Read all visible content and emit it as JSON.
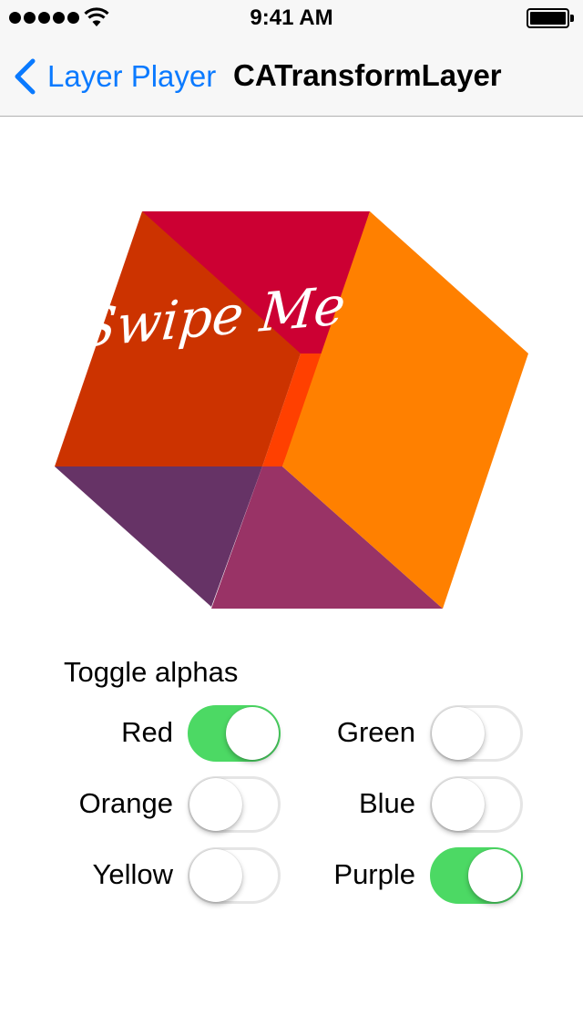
{
  "status_bar": {
    "time": "9:41 AM",
    "signal_bars": 5
  },
  "nav": {
    "back_label": "Layer Player",
    "title": "CATransformLayer"
  },
  "cube": {
    "label": "Swipe Me",
    "face_colors": {
      "red": "#cc0033",
      "orange": "#ff8000",
      "yellow": "#ffcc00",
      "green": "#33cc33",
      "blue": "#3366cc",
      "purple": "#993366"
    }
  },
  "toggles": {
    "heading": "Toggle alphas",
    "items": [
      {
        "label": "Red",
        "on": true
      },
      {
        "label": "Green",
        "on": false
      },
      {
        "label": "Orange",
        "on": false
      },
      {
        "label": "Blue",
        "on": false
      },
      {
        "label": "Yellow",
        "on": false
      },
      {
        "label": "Purple",
        "on": true
      }
    ]
  },
  "colors": {
    "accent": "#0a7aff",
    "switch_on": "#4cd964",
    "switch_border": "#e5e5e5"
  }
}
